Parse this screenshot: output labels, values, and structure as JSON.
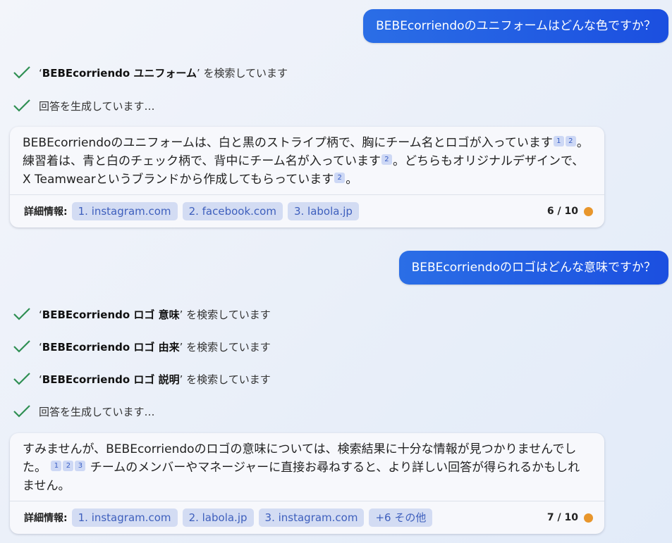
{
  "colors": {
    "user_bubble": "#1d58e3",
    "check": "#2f8f53",
    "chip_bg": "#d3dcf3",
    "chip_text": "#3e5fbd",
    "counter_dot": "#e8962c"
  },
  "conversation": {
    "turn1": {
      "user_message": "BEBEcorriendoのユニフォームはどんな色ですか？",
      "steps": [
        {
          "query": "BEBEcorriendo ユニフォーム",
          "suffix": "’ を検索しています"
        },
        {
          "text": "回答を生成しています…"
        }
      ],
      "answer": {
        "seg1": "BEBEcorriendoのユニフォームは、白と黒のストライプ柄で、胸にチーム名とロゴが入っています",
        "refs1": [
          "1",
          "2"
        ],
        "seg2": "。練習着は、青と白のチェック柄で、背中にチーム名が入っています",
        "refs2": [
          "2"
        ],
        "seg3": "。どちらもオリジナルデザインで、X Teamwearというブランドから作成してもらっています",
        "refs3": [
          "2"
        ],
        "seg4": "。"
      },
      "footer": {
        "label": "詳細情報:",
        "sources": [
          "1. instagram.com",
          "2. facebook.com",
          "3. labola.jp"
        ],
        "counter": "6 / 10"
      }
    },
    "turn2": {
      "user_message": "BEBEcorriendoのロゴはどんな意味ですか？",
      "steps": [
        {
          "query": "BEBEcorriendo ロゴ 意味",
          "suffix": "’ を検索しています"
        },
        {
          "query": "BEBEcorriendo ロゴ 由来",
          "suffix": "’ を検索しています"
        },
        {
          "query": "BEBEcorriendo ロゴ 説明",
          "suffix": "’ を検索しています"
        },
        {
          "text": "回答を生成しています…"
        }
      ],
      "answer": {
        "seg1": "すみませんが、BEBEcorriendoのロゴの意味については、検索結果に十分な情報が見つかりませんでした。",
        "refs1": [
          "1",
          "2",
          "3"
        ],
        "seg2": " チームのメンバーやマネージャーに直接お尋ねすると、より詳しい回答が得られるかもしれません。"
      },
      "footer": {
        "label": "詳細情報:",
        "sources": [
          "1. instagram.com",
          "2. labola.jp",
          "3. instagram.com"
        ],
        "more": "+6 その他",
        "counter": "7 / 10"
      }
    }
  }
}
